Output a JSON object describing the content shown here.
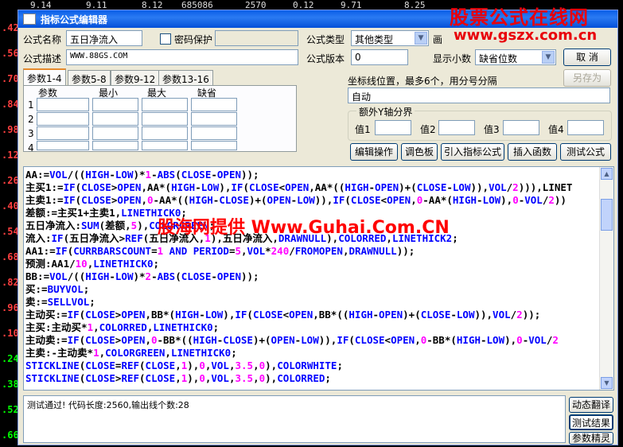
{
  "background": {
    "left_ticks": [
      {
        "text": ".42",
        "color": "#ff4040"
      },
      {
        "text": ".56",
        "color": "#ff4040"
      },
      {
        "text": ".70",
        "color": "#ff4040"
      },
      {
        "text": ".84",
        "color": "#ff4040"
      },
      {
        "text": ".98",
        "color": "#ff4040"
      },
      {
        "text": ".12",
        "color": "#ff4040"
      },
      {
        "text": ".26",
        "color": "#ff4040"
      },
      {
        "text": ".40",
        "color": "#ff4040"
      },
      {
        "text": ".54",
        "color": "#ff4040"
      },
      {
        "text": ".68",
        "color": "#ff4040"
      },
      {
        "text": ".82",
        "color": "#ff4040"
      },
      {
        "text": ".96",
        "color": "#ff4040"
      },
      {
        "text": ".10",
        "color": "#ff4040"
      },
      {
        "text": ".24",
        "color": "#00ff00"
      },
      {
        "text": ".38",
        "color": "#00ff00"
      },
      {
        "text": ".52",
        "color": "#00ff00"
      },
      {
        "text": ".66",
        "color": "#00ff00"
      }
    ],
    "top_values": [
      "9.14",
      "9.11",
      "8.12",
      "685086",
      "2570",
      "0.12",
      "9.71",
      "8.25"
    ]
  },
  "watermarks": {
    "site_title": "股票公式在线网",
    "site_url": "www.gszx.com.cn",
    "overlay": "股海网提供 Www.Guhai.Com.CN"
  },
  "dialog": {
    "title": "指标公式编辑器",
    "formula_name_label": "公式名称",
    "formula_name_value": "五日净流入",
    "password_label": "密码保护",
    "formula_type_label": "公式类型",
    "formula_type_value": "其他类型",
    "draw_label": "画",
    "formula_desc_label": "公式描述",
    "formula_desc_value": "WWW.88GS.COM",
    "formula_version_label": "公式版本",
    "formula_version_value": "0",
    "decimal_label": "显示小数",
    "decimal_value": "缺省位数",
    "cancel_label": "取  消",
    "save_as_label": "另存为",
    "tabs": [
      "参数1-4",
      "参数5-8",
      "参数9-12",
      "参数13-16"
    ],
    "param_headers": [
      "参数",
      "最小",
      "最大",
      "缺省"
    ],
    "param_rows": [
      "1",
      "2",
      "3",
      "4"
    ],
    "axis_label": "坐标线位置，最多6个，用分号分隔",
    "axis_value": "自动",
    "yaxis_group_label": "额外Y轴分界",
    "yaxis_values": [
      "值1",
      "值2",
      "值3",
      "值4"
    ],
    "buttons": [
      "编辑操作",
      "调色板",
      "引入指标公式",
      "插入函数",
      "测试公式"
    ],
    "code_lines": [
      [
        [
          "AA:=",
          "op"
        ],
        [
          "VOL",
          "fn"
        ],
        [
          "/((",
          "op"
        ],
        [
          "HIGH",
          "fn"
        ],
        [
          "-",
          "op"
        ],
        [
          "LOW",
          "fn"
        ],
        [
          ")*",
          "op"
        ],
        [
          "1",
          "nm"
        ],
        [
          "-",
          "op"
        ],
        [
          "ABS",
          "fn"
        ],
        [
          "(",
          "op"
        ],
        [
          "CLOSE",
          "fn"
        ],
        [
          "-",
          "op"
        ],
        [
          "OPEN",
          "fn"
        ],
        [
          "));",
          "op"
        ]
      ],
      [
        [
          "主买1:=",
          "op"
        ],
        [
          "IF",
          "fn"
        ],
        [
          "(",
          "op"
        ],
        [
          "CLOSE",
          "fn"
        ],
        [
          ">",
          "op"
        ],
        [
          "OPEN",
          "fn"
        ],
        [
          ",AA*(",
          "op"
        ],
        [
          "HIGH",
          "fn"
        ],
        [
          "-",
          "op"
        ],
        [
          "LOW",
          "fn"
        ],
        [
          "),",
          "op"
        ],
        [
          "IF",
          "fn"
        ],
        [
          "(",
          "op"
        ],
        [
          "CLOSE",
          "fn"
        ],
        [
          "<",
          "op"
        ],
        [
          "OPEN",
          "fn"
        ],
        [
          ",AA*((",
          "op"
        ],
        [
          "HIGH",
          "fn"
        ],
        [
          "-",
          "op"
        ],
        [
          "OPEN",
          "fn"
        ],
        [
          ")+(",
          "op"
        ],
        [
          "CLOSE",
          "fn"
        ],
        [
          "-",
          "op"
        ],
        [
          "LOW",
          "fn"
        ],
        [
          ")),",
          "op"
        ],
        [
          "VOL",
          "fn"
        ],
        [
          "/",
          "op"
        ],
        [
          "2",
          "nm"
        ],
        [
          "))),LINET",
          "op"
        ]
      ],
      [
        [
          "主卖1:=",
          "op"
        ],
        [
          "IF",
          "fn"
        ],
        [
          "(",
          "op"
        ],
        [
          "CLOSE",
          "fn"
        ],
        [
          ">",
          "op"
        ],
        [
          "OPEN",
          "fn"
        ],
        [
          ",",
          "op"
        ],
        [
          "0",
          "nm"
        ],
        [
          "-AA*((",
          "op"
        ],
        [
          "HIGH",
          "fn"
        ],
        [
          "-",
          "op"
        ],
        [
          "CLOSE",
          "fn"
        ],
        [
          ")+(",
          "op"
        ],
        [
          "OPEN",
          "fn"
        ],
        [
          "-",
          "op"
        ],
        [
          "LOW",
          "fn"
        ],
        [
          ")),",
          "op"
        ],
        [
          "IF",
          "fn"
        ],
        [
          "(",
          "op"
        ],
        [
          "CLOSE",
          "fn"
        ],
        [
          "<",
          "op"
        ],
        [
          "OPEN",
          "fn"
        ],
        [
          ",",
          "op"
        ],
        [
          "0",
          "nm"
        ],
        [
          "-AA*(",
          "op"
        ],
        [
          "HIGH",
          "fn"
        ],
        [
          "-",
          "op"
        ],
        [
          "LOW",
          "fn"
        ],
        [
          "),",
          "op"
        ],
        [
          "0",
          "nm"
        ],
        [
          "-",
          "op"
        ],
        [
          "VOL",
          "fn"
        ],
        [
          "/",
          "op"
        ],
        [
          "2",
          "nm"
        ],
        [
          "))",
          "op"
        ]
      ],
      [
        [
          "差额:=主买1+主卖1,",
          "op"
        ],
        [
          "LINETHICK0",
          "fn"
        ],
        [
          ";",
          "op"
        ]
      ],
      [
        [
          "五日净流入:",
          "op"
        ],
        [
          "SUM",
          "fn"
        ],
        [
          "(差额,",
          "op"
        ],
        [
          "5",
          "nm"
        ],
        [
          "),",
          "op"
        ],
        [
          "COLORGREEN",
          "fn"
        ],
        [
          ";",
          "op"
        ]
      ],
      [
        [
          "流入:",
          "op"
        ],
        [
          "IF",
          "fn"
        ],
        [
          "(五日净流入>",
          "op"
        ],
        [
          "REF",
          "fn"
        ],
        [
          "(五日净流入,",
          "op"
        ],
        [
          "1",
          "nm"
        ],
        [
          "),五日净流入,",
          "op"
        ],
        [
          "DRAWNULL",
          "fn"
        ],
        [
          "),",
          "op"
        ],
        [
          "COLORRED",
          "fn"
        ],
        [
          ",",
          "op"
        ],
        [
          "LINETHICK2",
          "fn"
        ],
        [
          ";",
          "op"
        ]
      ],
      [
        [
          "AA1:=",
          "op"
        ],
        [
          "IF",
          "fn"
        ],
        [
          "(",
          "op"
        ],
        [
          "CURRBARSCOUNT",
          "fn"
        ],
        [
          "=",
          "op"
        ],
        [
          "1",
          "nm"
        ],
        [
          " ",
          "op"
        ],
        [
          "AND",
          "fn"
        ],
        [
          " ",
          "op"
        ],
        [
          "PERIOD",
          "fn"
        ],
        [
          "=",
          "op"
        ],
        [
          "5",
          "nm"
        ],
        [
          ",",
          "op"
        ],
        [
          "VOL",
          "fn"
        ],
        [
          "*",
          "op"
        ],
        [
          "240",
          "nm"
        ],
        [
          "/",
          "op"
        ],
        [
          "FROMOPEN",
          "fn"
        ],
        [
          ",",
          "op"
        ],
        [
          "DRAWNULL",
          "fn"
        ],
        [
          "));",
          "op"
        ]
      ],
      [
        [
          "预测:AA1/",
          "op"
        ],
        [
          "10",
          "nm"
        ],
        [
          ",",
          "op"
        ],
        [
          "LINETHICK0",
          "fn"
        ],
        [
          ";",
          "op"
        ]
      ],
      [
        [
          "BB:=",
          "op"
        ],
        [
          "VOL",
          "fn"
        ],
        [
          "/((",
          "op"
        ],
        [
          "HIGH",
          "fn"
        ],
        [
          "-",
          "op"
        ],
        [
          "LOW",
          "fn"
        ],
        [
          ")*",
          "op"
        ],
        [
          "2",
          "nm"
        ],
        [
          "-",
          "op"
        ],
        [
          "ABS",
          "fn"
        ],
        [
          "(",
          "op"
        ],
        [
          "CLOSE",
          "fn"
        ],
        [
          "-",
          "op"
        ],
        [
          "OPEN",
          "fn"
        ],
        [
          "));",
          "op"
        ]
      ],
      [
        [
          "买:=",
          "op"
        ],
        [
          "BUYVOL",
          "fn"
        ],
        [
          ";",
          "op"
        ]
      ],
      [
        [
          "卖:=",
          "op"
        ],
        [
          "SELLVOL",
          "fn"
        ],
        [
          ";",
          "op"
        ]
      ],
      [
        [
          "主动买:=",
          "op"
        ],
        [
          "IF",
          "fn"
        ],
        [
          "(",
          "op"
        ],
        [
          "CLOSE",
          "fn"
        ],
        [
          ">",
          "op"
        ],
        [
          "OPEN",
          "fn"
        ],
        [
          ",BB*(",
          "op"
        ],
        [
          "HIGH",
          "fn"
        ],
        [
          "-",
          "op"
        ],
        [
          "LOW",
          "fn"
        ],
        [
          "),",
          "op"
        ],
        [
          "IF",
          "fn"
        ],
        [
          "(",
          "op"
        ],
        [
          "CLOSE",
          "fn"
        ],
        [
          "<",
          "op"
        ],
        [
          "OPEN",
          "fn"
        ],
        [
          ",BB*((",
          "op"
        ],
        [
          "HIGH",
          "fn"
        ],
        [
          "-",
          "op"
        ],
        [
          "OPEN",
          "fn"
        ],
        [
          ")+(",
          "op"
        ],
        [
          "CLOSE",
          "fn"
        ],
        [
          "-",
          "op"
        ],
        [
          "LOW",
          "fn"
        ],
        [
          ")),",
          "op"
        ],
        [
          "VOL",
          "fn"
        ],
        [
          "/",
          "op"
        ],
        [
          "2",
          "nm"
        ],
        [
          "));",
          "op"
        ]
      ],
      [
        [
          "主买:主动买*",
          "op"
        ],
        [
          "1",
          "nm"
        ],
        [
          ",",
          "op"
        ],
        [
          "COLORRED",
          "fn"
        ],
        [
          ",",
          "op"
        ],
        [
          "LINETHICK0",
          "fn"
        ],
        [
          ";",
          "op"
        ]
      ],
      [
        [
          "主动卖:=",
          "op"
        ],
        [
          "IF",
          "fn"
        ],
        [
          "(",
          "op"
        ],
        [
          "CLOSE",
          "fn"
        ],
        [
          ">",
          "op"
        ],
        [
          "OPEN",
          "fn"
        ],
        [
          ",",
          "op"
        ],
        [
          "0",
          "nm"
        ],
        [
          "-BB*((",
          "op"
        ],
        [
          "HIGH",
          "fn"
        ],
        [
          "-",
          "op"
        ],
        [
          "CLOSE",
          "fn"
        ],
        [
          ")+(",
          "op"
        ],
        [
          "OPEN",
          "fn"
        ],
        [
          "-",
          "op"
        ],
        [
          "LOW",
          "fn"
        ],
        [
          ")),",
          "op"
        ],
        [
          "IF",
          "fn"
        ],
        [
          "(",
          "op"
        ],
        [
          "CLOSE",
          "fn"
        ],
        [
          "<",
          "op"
        ],
        [
          "OPEN",
          "fn"
        ],
        [
          ",",
          "op"
        ],
        [
          "0",
          "nm"
        ],
        [
          "-BB*(",
          "op"
        ],
        [
          "HIGH",
          "fn"
        ],
        [
          "-",
          "op"
        ],
        [
          "LOW",
          "fn"
        ],
        [
          "),",
          "op"
        ],
        [
          "0",
          "nm"
        ],
        [
          "-",
          "op"
        ],
        [
          "VOL",
          "fn"
        ],
        [
          "/",
          "op"
        ],
        [
          "2",
          "nm"
        ]
      ],
      [
        [
          "主卖:-主动卖*",
          "op"
        ],
        [
          "1",
          "nm"
        ],
        [
          ",",
          "op"
        ],
        [
          "COLORGREEN",
          "fn"
        ],
        [
          ",",
          "op"
        ],
        [
          "LINETHICK0",
          "fn"
        ],
        [
          ";",
          "op"
        ]
      ],
      [
        [
          "STICKLINE",
          "fn"
        ],
        [
          "(",
          "op"
        ],
        [
          "CLOSE",
          "fn"
        ],
        [
          "=",
          "op"
        ],
        [
          "REF",
          "fn"
        ],
        [
          "(",
          "op"
        ],
        [
          "CLOSE",
          "fn"
        ],
        [
          ",",
          "op"
        ],
        [
          "1",
          "nm"
        ],
        [
          "),",
          "op"
        ],
        [
          "0",
          "nm"
        ],
        [
          ",",
          "op"
        ],
        [
          "VOL",
          "fn"
        ],
        [
          ",",
          "op"
        ],
        [
          "3.5",
          "nm"
        ],
        [
          ",",
          "op"
        ],
        [
          "0",
          "nm"
        ],
        [
          "),",
          "op"
        ],
        [
          "COLORWHITE",
          "fn"
        ],
        [
          ";",
          "op"
        ]
      ],
      [
        [
          "STICKLINE",
          "fn"
        ],
        [
          "(",
          "op"
        ],
        [
          "CLOSE",
          "fn"
        ],
        [
          ">",
          "op"
        ],
        [
          "REF",
          "fn"
        ],
        [
          "(",
          "op"
        ],
        [
          "CLOSE",
          "fn"
        ],
        [
          ",",
          "op"
        ],
        [
          "1",
          "nm"
        ],
        [
          "),",
          "op"
        ],
        [
          "0",
          "nm"
        ],
        [
          ",",
          "op"
        ],
        [
          "VOL",
          "fn"
        ],
        [
          ",",
          "op"
        ],
        [
          "3.5",
          "nm"
        ],
        [
          ",",
          "op"
        ],
        [
          "0",
          "nm"
        ],
        [
          "),",
          "op"
        ],
        [
          "COLORRED",
          "fn"
        ],
        [
          ";",
          "op"
        ]
      ]
    ],
    "status_text": "测试通过! 代码长度:2560,输出线个数:28",
    "side_buttons": [
      "动态翻译",
      "测试结果",
      "参数精灵"
    ]
  },
  "colors": {
    "function_blue": "#0000ff",
    "number_magenta": "#ff00ff",
    "titlebar_blue": "#0a5ee8",
    "watermark_red": "#e8000a"
  }
}
